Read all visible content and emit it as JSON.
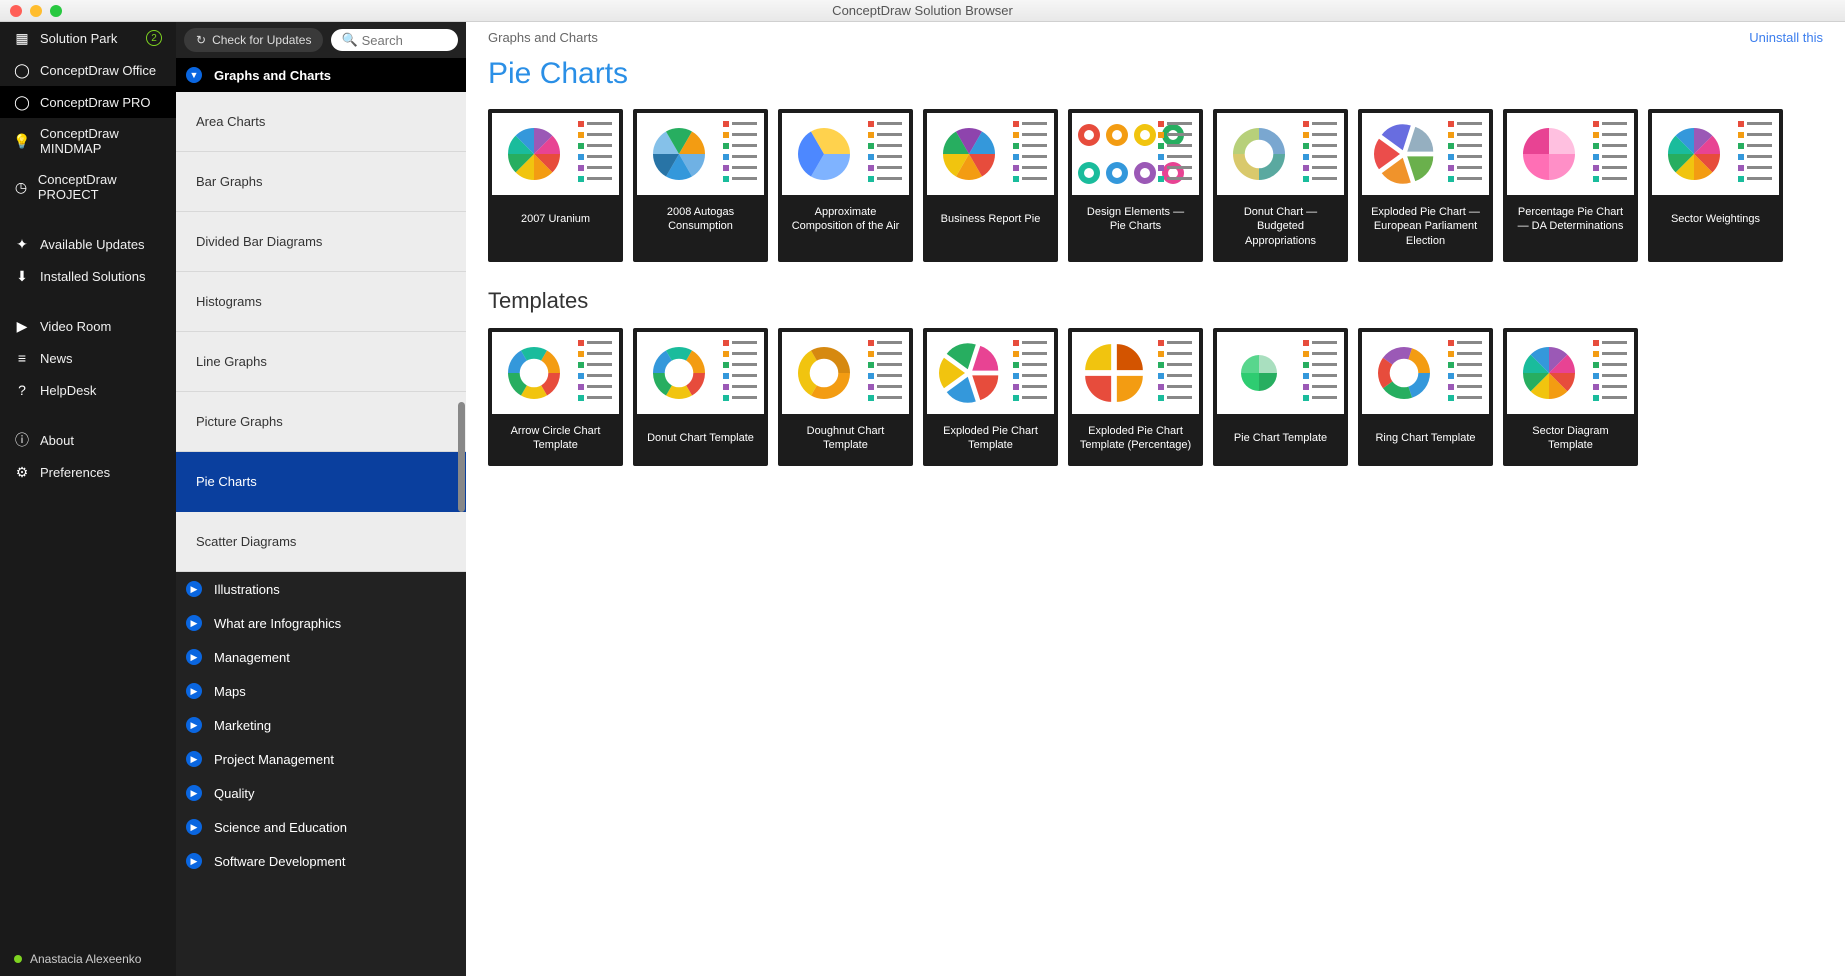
{
  "window": {
    "title": "ConceptDraw Solution Browser"
  },
  "sidebar": {
    "items": [
      {
        "label": "Solution Park",
        "icon": "grid",
        "badge": "2"
      },
      {
        "label": "ConceptDraw Office",
        "icon": "circle"
      },
      {
        "label": "ConceptDraw PRO",
        "icon": "circle",
        "active": true
      },
      {
        "label": "ConceptDraw MINDMAP",
        "icon": "bulb"
      },
      {
        "label": "ConceptDraw PROJECT",
        "icon": "clock"
      }
    ],
    "items2": [
      {
        "label": "Available Updates",
        "icon": "sparkle"
      },
      {
        "label": "Installed Solutions",
        "icon": "download"
      }
    ],
    "items3": [
      {
        "label": "Video Room",
        "icon": "play"
      },
      {
        "label": "News",
        "icon": "lines"
      },
      {
        "label": "HelpDesk",
        "icon": "question"
      }
    ],
    "items4": [
      {
        "label": "About",
        "icon": "info"
      },
      {
        "label": "Preferences",
        "icon": "gear"
      }
    ],
    "user": "Anastacia Alexeenko"
  },
  "navcol": {
    "check_updates": "Check for Updates",
    "search_placeholder": "Search",
    "current_category": "Graphs and Charts",
    "subitems": [
      "Area Charts",
      "Bar Graphs",
      "Divided Bar Diagrams",
      "Histograms",
      "Line Graphs",
      "Picture Graphs",
      "Pie Charts",
      "Scatter Diagrams"
    ],
    "selected_sub": "Pie Charts",
    "categories": [
      "Illustrations",
      "What are Infographics",
      "Management",
      "Maps",
      "Marketing",
      "Project Management",
      "Quality",
      "Science and Education",
      "Software Development"
    ]
  },
  "main": {
    "breadcrumb": "Graphs and Charts",
    "uninstall": "Uninstall this",
    "heading": "Pie Charts",
    "examples": [
      "2007 Uranium",
      "2008 Autogas Consumption",
      "Approximate Composition of the Air",
      "Business Report Pie",
      "Design Elements — Pie Charts",
      "Donut Chart — Budgeted Appropriations",
      "Exploded Pie Chart — European Parliament Election",
      "Percentage Pie Chart — DA Determinations",
      "Sector Weightings"
    ],
    "templates_heading": "Templates",
    "templates": [
      "Arrow Circle Chart Template",
      "Donut Chart Template",
      "Doughnut Chart Template",
      "Exploded Pie Chart Template",
      "Exploded Pie Chart Template (Percentage)",
      "Pie Chart Template",
      "Ring Chart Template",
      "Sector Diagram Template"
    ]
  }
}
